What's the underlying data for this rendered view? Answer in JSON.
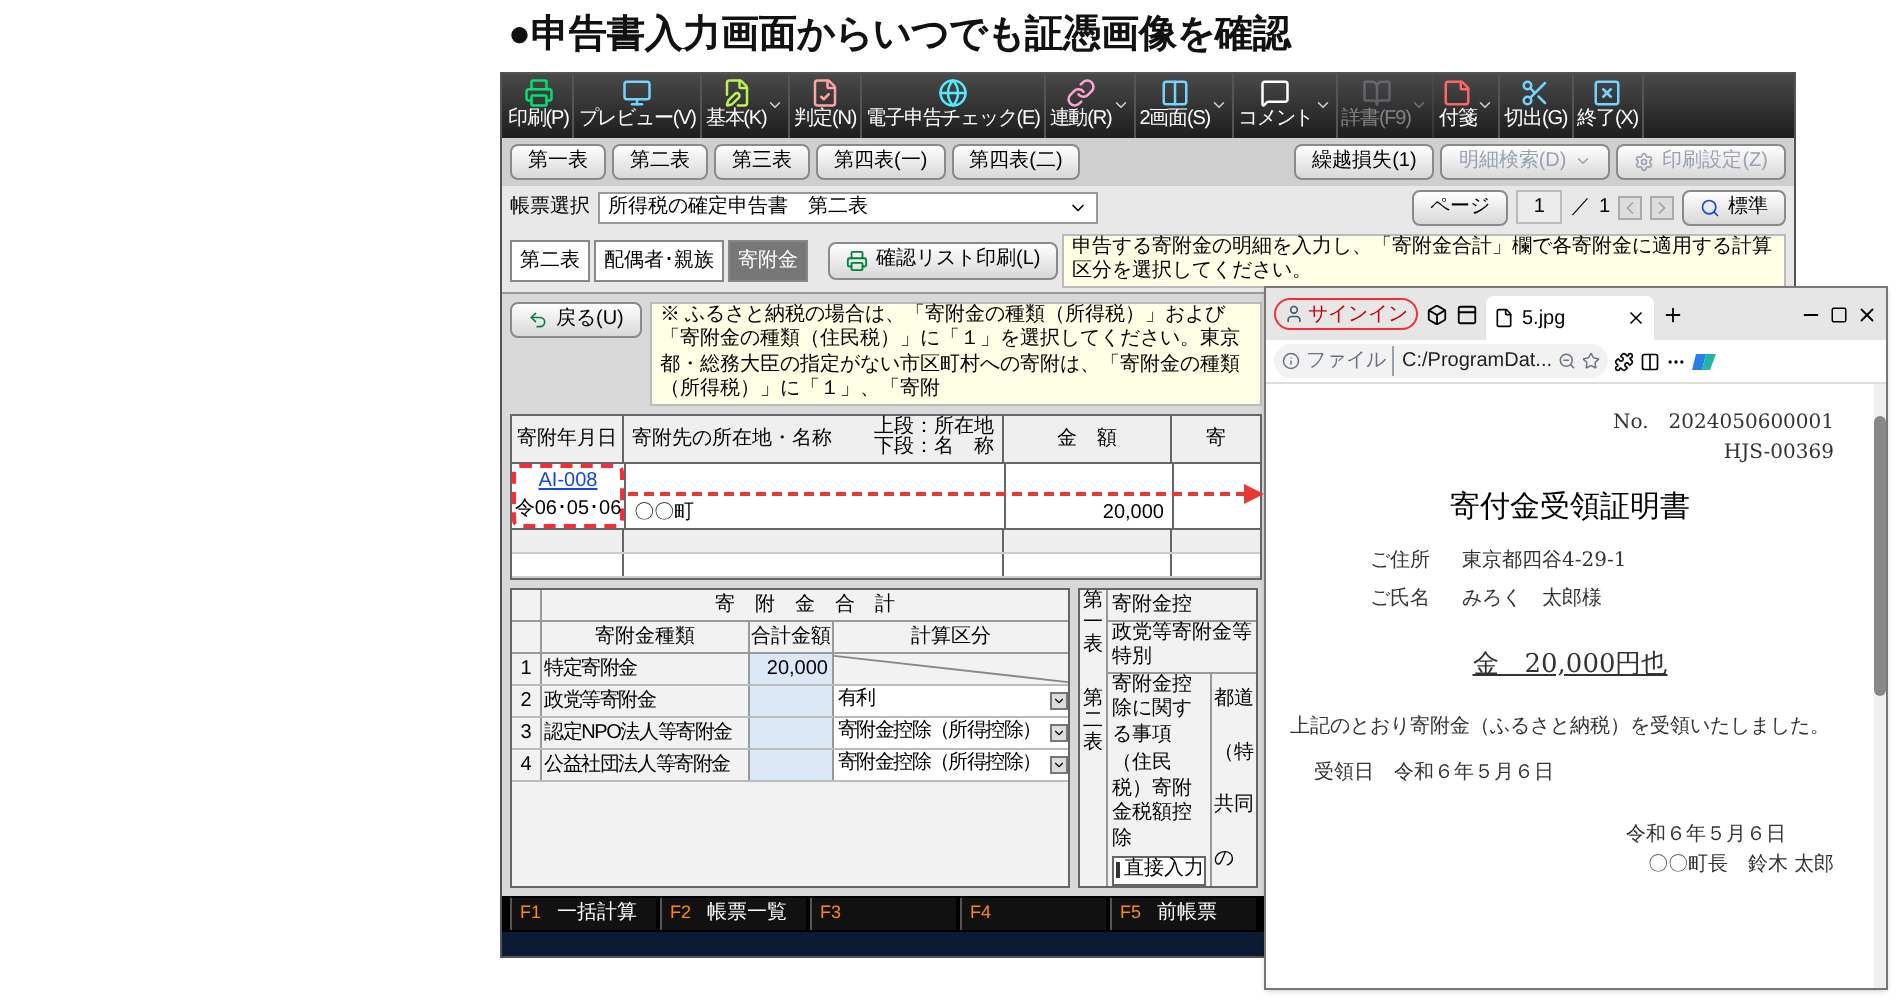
{
  "headline": "●申告書入力画面からいつでも証憑画像を確認",
  "app": {
    "toolbar": [
      {
        "label": "印刷(P)",
        "dropdown": false,
        "disabled": false
      },
      {
        "label": "プレビュー(V)",
        "dropdown": false,
        "disabled": false
      },
      {
        "label": "基本(K)",
        "dropdown": true,
        "disabled": false
      },
      {
        "label": "判定(N)",
        "dropdown": false,
        "disabled": false
      },
      {
        "label": "電子申告チェック(E)",
        "dropdown": false,
        "disabled": false
      },
      {
        "label": "連動(R)",
        "dropdown": true,
        "disabled": false
      },
      {
        "label": "2画面(S)",
        "dropdown": true,
        "disabled": false
      },
      {
        "label": "コメント",
        "dropdown": true,
        "disabled": false
      },
      {
        "label": "詳書(F9)",
        "dropdown": true,
        "disabled": true
      },
      {
        "label": "付箋",
        "dropdown": true,
        "disabled": false
      },
      {
        "label": "切出(G)",
        "dropdown": false,
        "disabled": false
      },
      {
        "label": "終了(X)",
        "dropdown": false,
        "disabled": false
      }
    ],
    "form_buttons": [
      {
        "label": "第一表",
        "kind": "plain",
        "disabled": false
      },
      {
        "label": "第二表",
        "kind": "plain",
        "disabled": false
      },
      {
        "label": "第三表",
        "kind": "plain",
        "disabled": false
      },
      {
        "label": "第四表(一)",
        "kind": "plain",
        "disabled": false
      },
      {
        "label": "第四表(二)",
        "kind": "plain",
        "disabled": false
      },
      {
        "label": "繰越損失(1)",
        "kind": "plain",
        "disabled": false
      },
      {
        "label": "明細検索(D)",
        "kind": "dropdown",
        "disabled": true
      },
      {
        "label": "印刷設定(Z)",
        "kind": "icon",
        "disabled": true
      }
    ],
    "form_select": {
      "label": "帳票選択",
      "value": "所得税の確定申告書　第二表"
    },
    "pager": {
      "button": "ページ",
      "current": "1",
      "separator": "／",
      "total": "1",
      "zoom_button": "標準"
    },
    "sheet_tabs": [
      {
        "label": "第二表",
        "selected": false
      },
      {
        "label": "配偶者･親族",
        "selected": false
      },
      {
        "label": "寄附金",
        "selected": true
      }
    ],
    "confirm_print": "確認リスト印刷(L)",
    "hint": "申告する寄附金の明細を入力し、「寄附金合計」欄で各寄附金に適用する計算区分を選択してください。",
    "back_button": "戻る(U)",
    "notice": "※ ふるさと納税の場合は、「寄附金の種類（所得税）」および「寄附金の種類（住民税）」に「１」を選択してください。東京都・総務大臣の指定がない市区町村への寄附は、「寄附金の種類（所得税）」に「１」、「寄附",
    "donations": {
      "columns": [
        {
          "label": "寄附年月日"
        },
        {
          "label": "寄附先の所在地・名称",
          "notes": [
            "上段：所在地",
            "下段：名　称"
          ]
        },
        {
          "label": "金　額"
        },
        {
          "label": "寄"
        }
      ],
      "rows": [
        {
          "code": "AI-008",
          "date": "令06･05･06",
          "name": "〇〇町",
          "amount": "20,000"
        }
      ]
    },
    "totals": {
      "title": "寄　附　金　合　計",
      "columns": [
        "寄附金種類",
        "合計金額",
        "計算区分"
      ],
      "rows": [
        {
          "no": "1",
          "label": "特定寄附金",
          "amount": "20,000"
        },
        {
          "no": "2",
          "label": "政党等寄附金",
          "method": "有利"
        },
        {
          "no": "3",
          "label": "認定NPO法人等寄附金",
          "method": "寄附金控除（所得控除）"
        },
        {
          "no": "4",
          "label": "公益社団法人等寄附金",
          "method": "寄附金控除（所得控除）"
        }
      ]
    },
    "side_panel": {
      "section_1": "第一表",
      "header": "寄附金控",
      "row": "政党等寄附金等特別",
      "section_2": "第二表",
      "item_1": "寄附金控除に関する事項",
      "item_2": "（住民税）寄附金税額控除",
      "direct_input": {
        "label": "直接入力",
        "checked": false
      },
      "fragments": [
        "都道",
        "（特",
        "共同",
        "の"
      ]
    },
    "fkeys": [
      {
        "key": "F1",
        "label": "一括計算"
      },
      {
        "key": "F2",
        "label": "帳票一覧"
      },
      {
        "key": "F3"
      },
      {
        "key": "F4"
      },
      {
        "key": "F5",
        "label": "前帳票"
      }
    ]
  },
  "browser": {
    "signin": "サインイン",
    "tab_title": "5.jpg",
    "address_label": "ファイル",
    "url": "C:/ProgramDat...",
    "document": {
      "number": "No.　2024050600001",
      "code": "HJS-00369",
      "title": "寄付金受領証明書",
      "address_label": "ご住所",
      "address": "東京都四谷4-29-1",
      "name_label": "ご氏名",
      "name": "みろく　太郎様",
      "amount": "金　20,000円也",
      "body": "上記のとおり寄附金（ふるさと納税）を受領いたしました。",
      "received": "受領日　令和６年５月６日",
      "date": "令和６年５月６日",
      "issuer": "〇〇町長　鈴木 太郎"
    }
  }
}
